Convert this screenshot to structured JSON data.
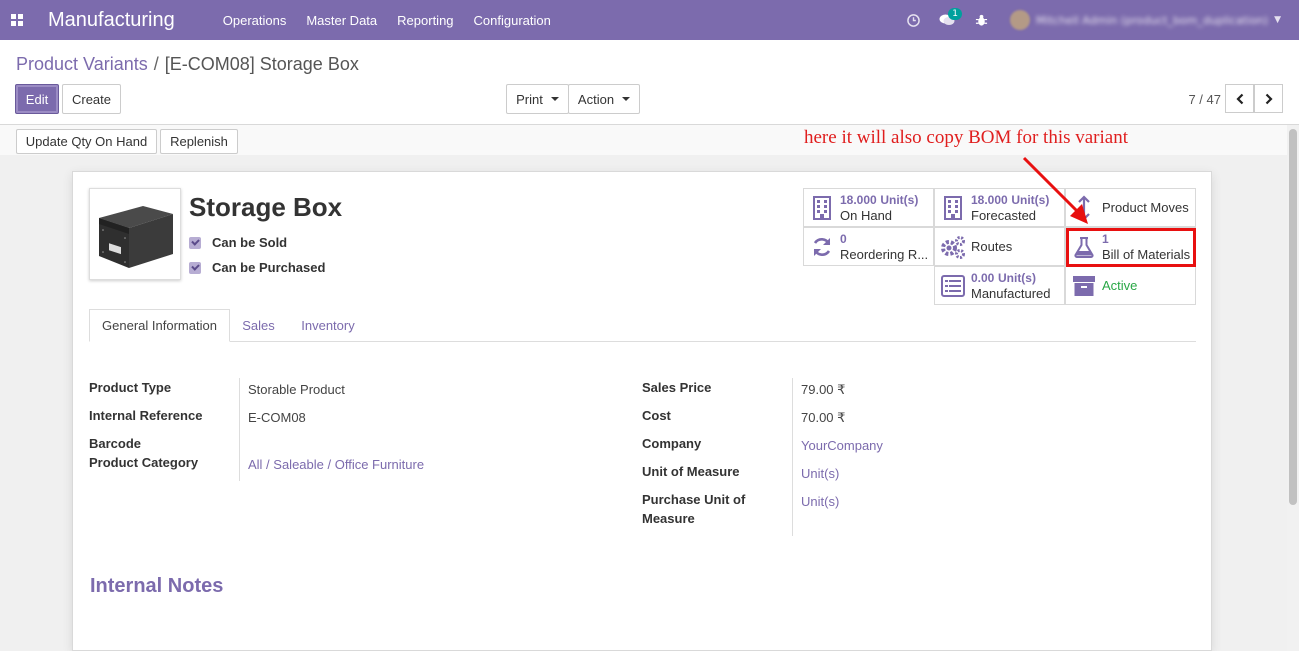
{
  "app": {
    "title": "Manufacturing",
    "menu": [
      "Operations",
      "Master Data",
      "Reporting",
      "Configuration"
    ],
    "chat_badge": "1",
    "user_name": "Mitchell Admin (product_bom_duplication)"
  },
  "breadcrumb": {
    "parent": "Product Variants",
    "separator": "/",
    "current": "[E-COM08] Storage Box"
  },
  "buttons": {
    "edit": "Edit",
    "create": "Create",
    "print": "Print",
    "action": "Action",
    "update_qty": "Update Qty On Hand",
    "replenish": "Replenish"
  },
  "pager": {
    "value": "7 / 47",
    "prev": "‹",
    "next": "›"
  },
  "annotation": "here it will also copy BOM for this variant",
  "product": {
    "name": "Storage Box",
    "can_be_sold_label": "Can be Sold",
    "can_be_purchased_label": "Can be Purchased",
    "can_be_sold": true,
    "can_be_purchased": true
  },
  "smart_buttons": {
    "on_hand": {
      "value": "18.000",
      "unit": "Unit(s)",
      "label": "On Hand",
      "icon": "building-icon"
    },
    "forecasted": {
      "value": "18.000",
      "unit": "Unit(s)",
      "label": "Forecasted",
      "icon": "building-icon"
    },
    "product_moves": {
      "label": "Product Moves",
      "icon": "updown-arrow-icon"
    },
    "reordering": {
      "value": "0",
      "label": "Reordering R...",
      "icon": "refresh-icon"
    },
    "routes": {
      "label": "Routes",
      "icon": "gears-icon"
    },
    "bom": {
      "value": "1",
      "label": "Bill of Materials",
      "icon": "flask-icon"
    },
    "manufactured": {
      "value": "0.00",
      "unit": "Unit(s)",
      "label": "Manufactured",
      "icon": "list-icon"
    },
    "active": {
      "label": "Active",
      "icon": "archive-icon"
    }
  },
  "tabs": [
    "General Information",
    "Sales",
    "Inventory"
  ],
  "fields_left": {
    "product_type_label": "Product Type",
    "product_type": "Storable Product",
    "internal_ref_label": "Internal Reference",
    "internal_ref": "E-COM08",
    "barcode_label": "Barcode",
    "category_label": "Product Category",
    "category": "All / Saleable / Office Furniture"
  },
  "fields_right": {
    "sales_price_label": "Sales Price",
    "sales_price": "79.00 ₹",
    "cost_label": "Cost",
    "cost": "70.00 ₹",
    "company_label": "Company",
    "company": "YourCompany",
    "uom_label": "Unit of Measure",
    "uom": "Unit(s)",
    "purchase_uom_label_1": "Purchase Unit of",
    "purchase_uom_label_2": "Measure",
    "purchase_uom": "Unit(s)"
  },
  "internal_notes_title": "Internal Notes",
  "colors": {
    "brand": "#7c6bad",
    "annotation": "#e01e1e",
    "active_green": "#28a745"
  }
}
